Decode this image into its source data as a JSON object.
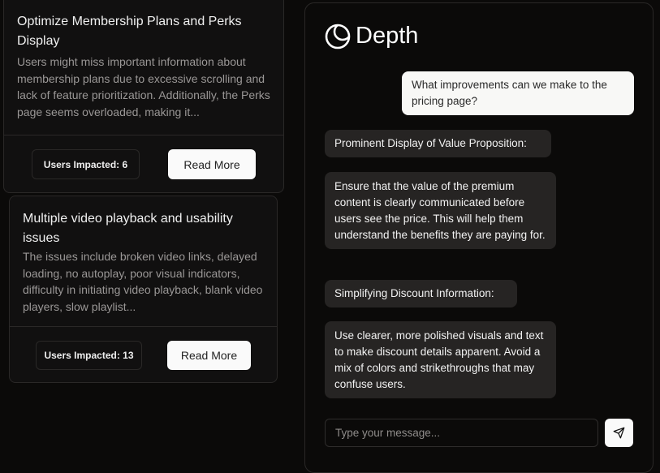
{
  "issues": [
    {
      "title": "Optimize Membership Plans and Perks Display",
      "description": "Users might miss important information about membership plans due to excessive scrolling and lack of feature prioritization. Additionally, the Perks page seems overloaded, making it...",
      "impact": "Users Impacted: 6",
      "button": "Read More"
    },
    {
      "title": "Multiple video playback and usability issues",
      "description": "The issues include broken video links, delayed loading, no autoplay, poor visual indicators, difficulty in initiating video playback, blank video players, slow playlist...",
      "impact": "Users Impacted: 13",
      "button": "Read More"
    }
  ],
  "chat": {
    "brand": "Depth",
    "messages": [
      {
        "role": "user",
        "text": "What improvements can we make to the pricing page?"
      },
      {
        "role": "assistant",
        "text": "Prominent Display of Value Proposition:"
      },
      {
        "role": "assistant",
        "text": "Ensure that the value of the premium content is clearly communicated before users see the price. This will help them understand the benefits they are paying for."
      },
      {
        "role": "assistant",
        "text": "Simplifying Discount Information:"
      },
      {
        "role": "assistant",
        "text": "Use clearer, more polished visuals and text to make discount details apparent. Avoid a mix of colors and strikethroughs that may confuse users."
      }
    ],
    "input_placeholder": "Type your message...",
    "input_value": ""
  }
}
